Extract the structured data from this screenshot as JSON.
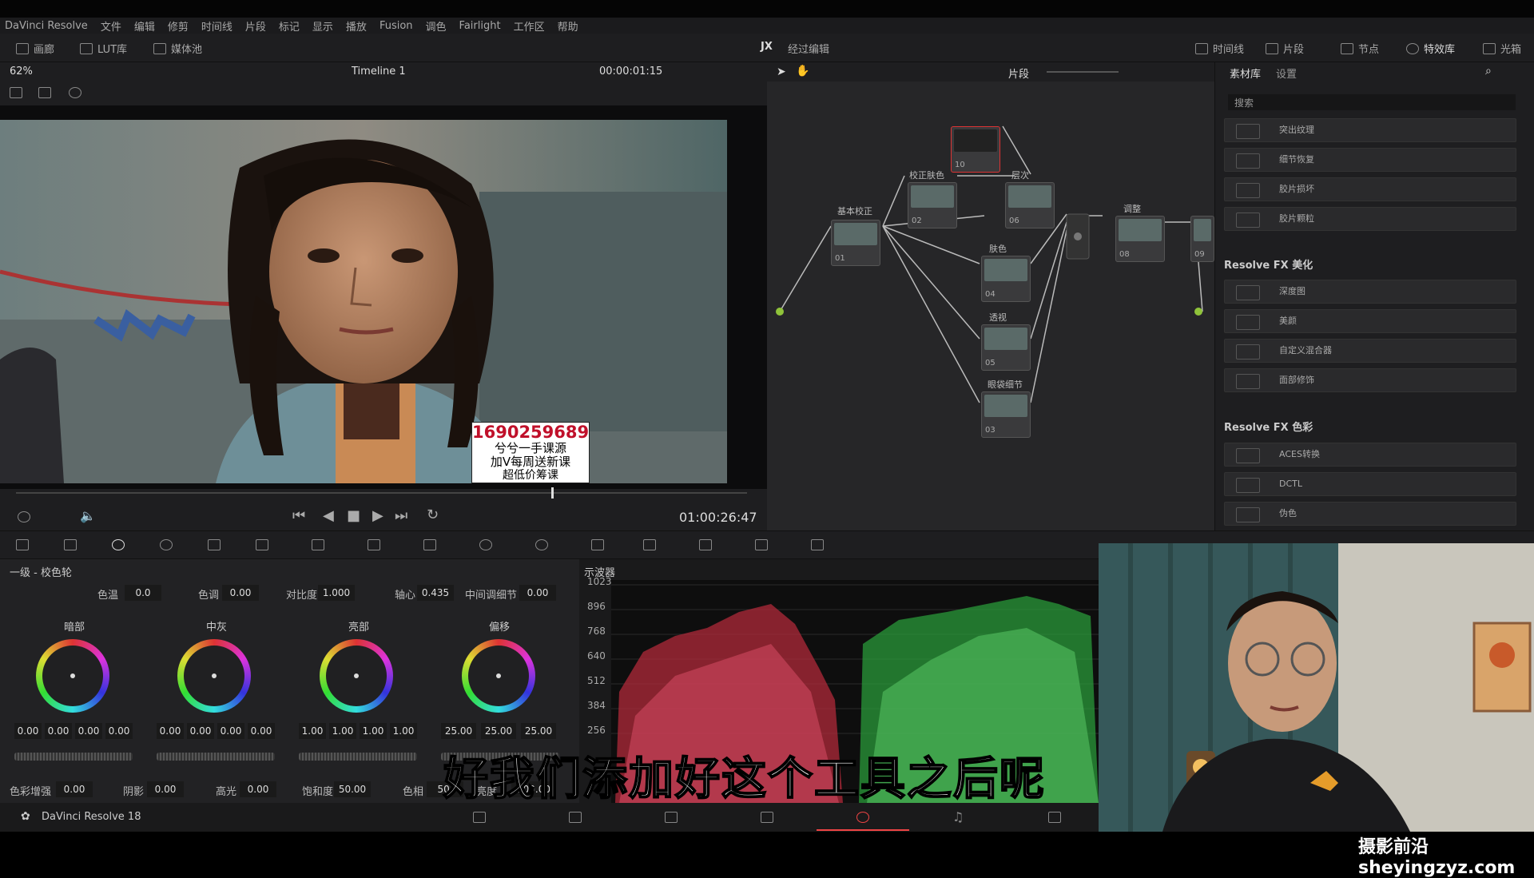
{
  "menu": [
    "DaVinci Resolve",
    "文件",
    "编辑",
    "修剪",
    "时间线",
    "片段",
    "标记",
    "显示",
    "播放",
    "Fusion",
    "调色",
    "Fairlight",
    "工作区",
    "帮助"
  ],
  "toolbar": {
    "gallery": "画廊",
    "lut": "LUT库",
    "media": "媒体池",
    "center_icon": "JX",
    "center_title": "经过编辑",
    "timeline": "时间线",
    "clips": "片段",
    "nodes": "节点",
    "effects": "特效库",
    "lightbox": "光箱"
  },
  "viewer": {
    "zoom": "62%",
    "timeline_name": "Timeline 1",
    "timecode_top": "00:00:01:15",
    "timecode": "01:00:26:47"
  },
  "overlay": {
    "number": "1690259689",
    "line1": "兮兮一手课源",
    "line2": "加V每周送新课",
    "line3": "超低价筹课"
  },
  "nodes_hdr": {
    "clip": "片段"
  },
  "nodes": [
    {
      "label": "基本校正",
      "num": "01"
    },
    {
      "label": "校正肤色",
      "num": "02"
    },
    {
      "label": "层次",
      "num": "06"
    },
    {
      "label": "",
      "num": "10"
    },
    {
      "label": "肤色",
      "num": "04"
    },
    {
      "label": "透视",
      "num": "05"
    },
    {
      "label": "眼袋细节",
      "num": "03"
    },
    {
      "label": "调整",
      "num": "08"
    },
    {
      "label": "",
      "num": "09"
    }
  ],
  "fx": {
    "tab_library": "素材库",
    "tab_settings": "设置",
    "search_placeholder": "搜索",
    "items_top": [
      "突出纹理",
      "细节恢复",
      "胶片损坏",
      "胶片颗粒"
    ],
    "section1": "Resolve FX 美化",
    "items1": [
      "深度图",
      "美颜",
      "自定义混合器",
      "面部修饰"
    ],
    "section2": "Resolve FX 色彩",
    "items2": [
      "ACES转换",
      "DCTL",
      "伪色"
    ]
  },
  "wheels": {
    "title": "一级 - 校色轮",
    "temp_label": "色温",
    "temp": "0.0",
    "tint_label": "色调",
    "tint": "0.00",
    "contrast_label": "对比度",
    "contrast": "1.000",
    "pivot_label": "轴心",
    "pivot": "0.435",
    "md_label": "中间调细节",
    "md": "0.00",
    "names": [
      "暗部",
      "中灰",
      "亮部",
      "偏移"
    ],
    "vals": [
      [
        "0.00",
        "0.00",
        "0.00",
        "0.00"
      ],
      [
        "0.00",
        "0.00",
        "0.00",
        "0.00"
      ],
      [
        "1.00",
        "1.00",
        "1.00",
        "1.00"
      ],
      [
        "25.00",
        "25.00",
        "25.00"
      ]
    ],
    "boost_label": "色彩增强",
    "boost": "0.00",
    "shadow_label": "阴影",
    "shadow": "0.00",
    "hl_label": "高光",
    "hl": "0.00",
    "sat_label": "饱和度",
    "sat": "50.00",
    "hue_label": "色相",
    "hue": "50.",
    "lum_label": "亮度",
    "lum": "100.00"
  },
  "scope": {
    "title": "示波器",
    "ticks": [
      "1023",
      "896",
      "768",
      "640",
      "512",
      "384",
      "256"
    ]
  },
  "app_name": "DaVinci Resolve 18",
  "subtitle": "好我们添加好这个工具之后呢",
  "watermark": "摄影前沿sheyingzyz.com"
}
